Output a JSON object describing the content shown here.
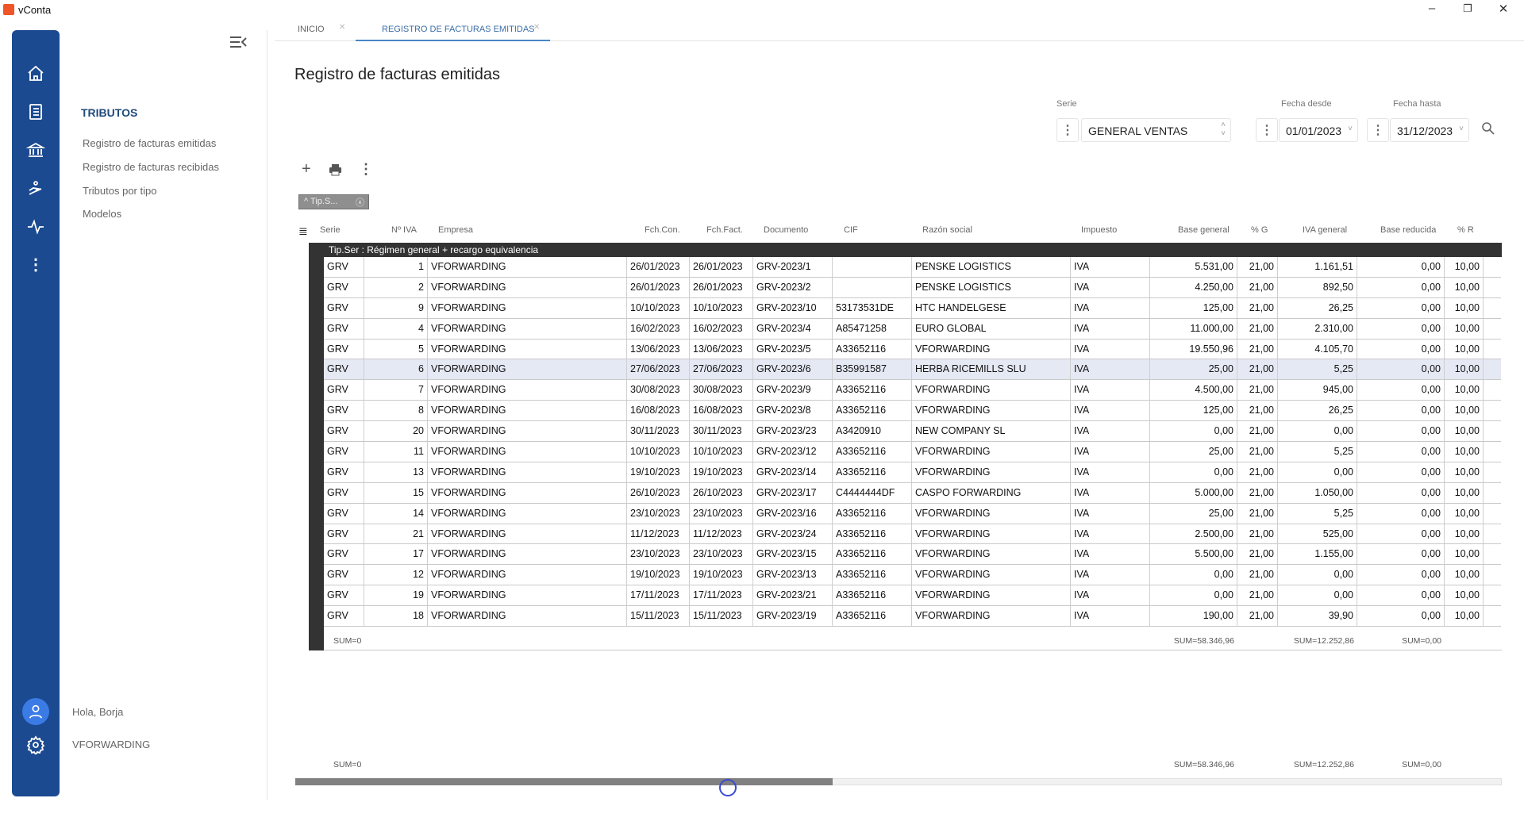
{
  "app": {
    "title": "vConta"
  },
  "window": {
    "minimize": "–",
    "restore": "❐",
    "close": "✕"
  },
  "sidebar": {
    "section": "TRIBUTOS",
    "items": [
      {
        "label": "Registro de facturas emitidas"
      },
      {
        "label": "Registro de facturas recibidas"
      },
      {
        "label": "Tributos por tipo"
      },
      {
        "label": "Modelos"
      }
    ],
    "greeting": "Hola, Borja",
    "company": "VFORWARDING"
  },
  "tabs": [
    {
      "label": "INICIO"
    },
    {
      "label": "REGISTRO DE FACTURAS EMITIDAS"
    }
  ],
  "page": {
    "title": "Registro de facturas emitidas"
  },
  "filters": {
    "serie_label": "Serie",
    "serie_value": "GENERAL VENTAS",
    "desde_label": "Fecha desde",
    "desde_value": "01/01/2023",
    "hasta_label": "Fecha hasta",
    "hasta_value": "31/12/2023"
  },
  "group_chip": {
    "label": "Tip.S..."
  },
  "table": {
    "columns": [
      "Serie",
      "Nº IVA",
      "Empresa",
      "Fch.Con.",
      "Fch.Fact.",
      "Documento",
      "CIF",
      "Razón social",
      "Impuesto",
      "Base general",
      "% G",
      "IVA general",
      "Base reducida",
      "% R"
    ],
    "group_label": "Tip.Ser : Régimen general + recargo equivalencia",
    "rows": [
      [
        "GRV",
        "1",
        "VFORWARDING",
        "26/01/2023",
        "26/01/2023",
        "GRV-2023/1",
        "",
        "PENSKE LOGISTICS",
        "IVA",
        "5.531,00",
        "21,00",
        "1.161,51",
        "0,00",
        "10,00"
      ],
      [
        "GRV",
        "2",
        "VFORWARDING",
        "26/01/2023",
        "26/01/2023",
        "GRV-2023/2",
        "",
        "PENSKE LOGISTICS",
        "IVA",
        "4.250,00",
        "21,00",
        "892,50",
        "0,00",
        "10,00"
      ],
      [
        "GRV",
        "9",
        "VFORWARDING",
        "10/10/2023",
        "10/10/2023",
        "GRV-2023/10",
        "53173531DE",
        "HTC HANDELGESE",
        "IVA",
        "125,00",
        "21,00",
        "26,25",
        "0,00",
        "10,00"
      ],
      [
        "GRV",
        "4",
        "VFORWARDING",
        "16/02/2023",
        "16/02/2023",
        "GRV-2023/4",
        "A85471258",
        "EURO GLOBAL",
        "IVA",
        "11.000,00",
        "21,00",
        "2.310,00",
        "0,00",
        "10,00"
      ],
      [
        "GRV",
        "5",
        "VFORWARDING",
        "13/06/2023",
        "13/06/2023",
        "GRV-2023/5",
        "A33652116",
        "VFORWARDING",
        "IVA",
        "19.550,96",
        "21,00",
        "4.105,70",
        "0,00",
        "10,00"
      ],
      [
        "GRV",
        "6",
        "VFORWARDING",
        "27/06/2023",
        "27/06/2023",
        "GRV-2023/6",
        "B35991587",
        "HERBA RICEMILLS SLU",
        "IVA",
        "25,00",
        "21,00",
        "5,25",
        "0,00",
        "10,00"
      ],
      [
        "GRV",
        "7",
        "VFORWARDING",
        "30/08/2023",
        "30/08/2023",
        "GRV-2023/9",
        "A33652116",
        "VFORWARDING",
        "IVA",
        "4.500,00",
        "21,00",
        "945,00",
        "0,00",
        "10,00"
      ],
      [
        "GRV",
        "8",
        "VFORWARDING",
        "16/08/2023",
        "16/08/2023",
        "GRV-2023/8",
        "A33652116",
        "VFORWARDING",
        "IVA",
        "125,00",
        "21,00",
        "26,25",
        "0,00",
        "10,00"
      ],
      [
        "GRV",
        "20",
        "VFORWARDING",
        "30/11/2023",
        "30/11/2023",
        "GRV-2023/23",
        "A3420910",
        "NEW COMPANY SL",
        "IVA",
        "0,00",
        "21,00",
        "0,00",
        "0,00",
        "10,00"
      ],
      [
        "GRV",
        "11",
        "VFORWARDING",
        "10/10/2023",
        "10/10/2023",
        "GRV-2023/12",
        "A33652116",
        "VFORWARDING",
        "IVA",
        "25,00",
        "21,00",
        "5,25",
        "0,00",
        "10,00"
      ],
      [
        "GRV",
        "13",
        "VFORWARDING",
        "19/10/2023",
        "19/10/2023",
        "GRV-2023/14",
        "A33652116",
        "VFORWARDING",
        "IVA",
        "0,00",
        "21,00",
        "0,00",
        "0,00",
        "10,00"
      ],
      [
        "GRV",
        "15",
        "VFORWARDING",
        "26/10/2023",
        "26/10/2023",
        "GRV-2023/17",
        "C4444444DF",
        "CASPO FORWARDING",
        "IVA",
        "5.000,00",
        "21,00",
        "1.050,00",
        "0,00",
        "10,00"
      ],
      [
        "GRV",
        "14",
        "VFORWARDING",
        "23/10/2023",
        "23/10/2023",
        "GRV-2023/16",
        "A33652116",
        "VFORWARDING",
        "IVA",
        "25,00",
        "21,00",
        "5,25",
        "0,00",
        "10,00"
      ],
      [
        "GRV",
        "21",
        "VFORWARDING",
        "11/12/2023",
        "11/12/2023",
        "GRV-2023/24",
        "A33652116",
        "VFORWARDING",
        "IVA",
        "2.500,00",
        "21,00",
        "525,00",
        "0,00",
        "10,00"
      ],
      [
        "GRV",
        "17",
        "VFORWARDING",
        "23/10/2023",
        "23/10/2023",
        "GRV-2023/15",
        "A33652116",
        "VFORWARDING",
        "IVA",
        "5.500,00",
        "21,00",
        "1.155,00",
        "0,00",
        "10,00"
      ],
      [
        "GRV",
        "12",
        "VFORWARDING",
        "19/10/2023",
        "19/10/2023",
        "GRV-2023/13",
        "A33652116",
        "VFORWARDING",
        "IVA",
        "0,00",
        "21,00",
        "0,00",
        "0,00",
        "10,00"
      ],
      [
        "GRV",
        "19",
        "VFORWARDING",
        "17/11/2023",
        "17/11/2023",
        "GRV-2023/21",
        "A33652116",
        "VFORWARDING",
        "IVA",
        "0,00",
        "21,00",
        "0,00",
        "0,00",
        "10,00"
      ],
      [
        "GRV",
        "18",
        "VFORWARDING",
        "15/11/2023",
        "15/11/2023",
        "GRV-2023/19",
        "A33652116",
        "VFORWARDING",
        "IVA",
        "190,00",
        "21,00",
        "39,90",
        "0,00",
        "10,00"
      ]
    ],
    "selected_row": 5,
    "summary": {
      "count": "SUM=0",
      "base_general": "SUM=58.346,96",
      "iva_general": "SUM=12.252,86",
      "base_reducida": "SUM=0,00"
    },
    "footer_summary": {
      "count": "SUM=0",
      "base_general": "SUM=58.346,96",
      "iva_general": "SUM=12.252,86",
      "base_reducida": "SUM=0,00"
    }
  },
  "colors": {
    "rail": "#1b4a91",
    "accent": "#4a86c5",
    "group_band": "#333333"
  }
}
